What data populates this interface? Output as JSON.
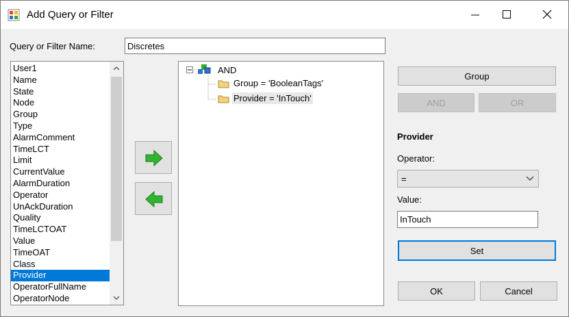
{
  "window": {
    "title": "Add Query or Filter"
  },
  "name_field": {
    "label": "Query or Filter Name:",
    "value": "Discretes"
  },
  "fields_list": {
    "items": [
      "User1",
      "Name",
      "State",
      "Node",
      "Group",
      "Type",
      "AlarmComment",
      "TimeLCT",
      "Limit",
      "CurrentValue",
      "AlarmDuration",
      "Operator",
      "UnAckDuration",
      "Quality",
      "TimeLCTOAT",
      "Value",
      "TimeOAT",
      "Class",
      "Provider",
      "OperatorFullName",
      "OperatorNode"
    ],
    "selected": "Provider"
  },
  "tree": {
    "root": "AND",
    "children": [
      "Group = 'BooleanTags'",
      "Provider = 'InTouch'"
    ],
    "selected_index": 1
  },
  "buttons": {
    "group": "Group",
    "and": "AND",
    "or": "OR",
    "set": "Set",
    "ok": "OK",
    "cancel": "Cancel"
  },
  "condition": {
    "field_title": "Provider",
    "operator_label": "Operator:",
    "operator_value": "=",
    "value_label": "Value:",
    "value": "InTouch"
  },
  "colors": {
    "selection": "#0078d7",
    "arrow_green": "#2fb52f",
    "default_button_border": "#0078d7"
  }
}
